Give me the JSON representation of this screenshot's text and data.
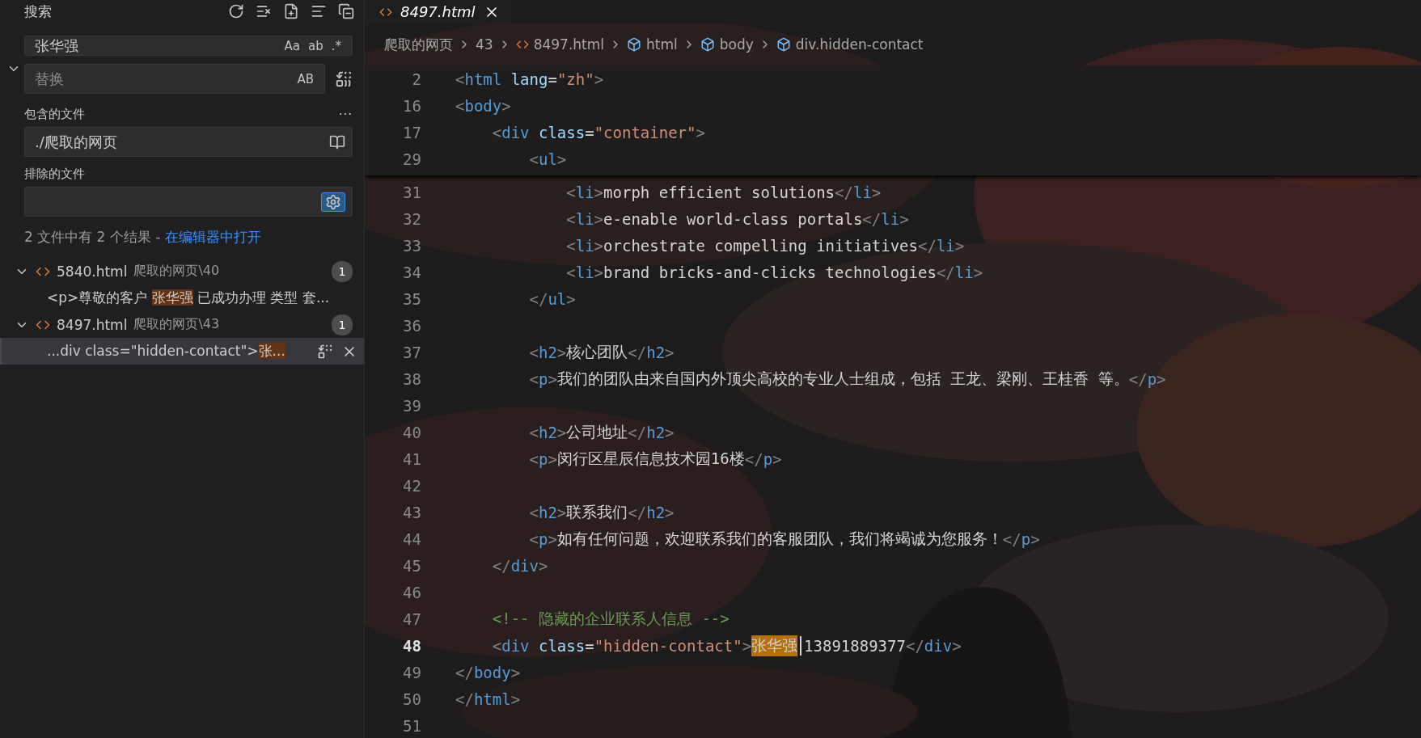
{
  "sidebar": {
    "title": "搜索",
    "search": {
      "value": "张华强",
      "toggles": [
        {
          "label": "Aa",
          "on": false
        },
        {
          "label": "ab",
          "on": false
        },
        {
          "label": ".*",
          "on": false
        }
      ]
    },
    "replace": {
      "placeholder": "替换",
      "toggle": {
        "label": "AB",
        "on": false
      }
    },
    "include": {
      "label": "包含的文件",
      "value": "./爬取的网页",
      "more": "···"
    },
    "exclude": {
      "label": "排除的文件",
      "settings_on": true
    },
    "summary": {
      "text": "2 文件中有 2 个结果 - ",
      "link": "在编辑器中打开"
    },
    "results": [
      {
        "name": "5840.html",
        "path": "爬取的网页\\40",
        "count": "1",
        "expanded": true,
        "children": [
          {
            "prefix": "<p>尊敬的客户 ",
            "match": "张华强",
            "suffix": " 已成功办理 类型 套...",
            "selected": false
          }
        ]
      },
      {
        "name": "8497.html",
        "path": "爬取的网页\\43",
        "count": "1",
        "expanded": true,
        "children": [
          {
            "prefix": "...div class=\"hidden-contact\">",
            "match": "张...",
            "selected": true
          }
        ]
      }
    ]
  },
  "editor": {
    "tabs": [
      {
        "label": "8497.html",
        "selected": true
      }
    ],
    "breadcrumbs": [
      {
        "kind": "folder",
        "label": "爬取的网页"
      },
      {
        "kind": "folder",
        "label": "43"
      },
      {
        "kind": "file",
        "label": "8497.html"
      },
      {
        "kind": "element",
        "label": "html"
      },
      {
        "kind": "element",
        "label": "body"
      },
      {
        "kind": "element",
        "label": "div.hidden-contact"
      }
    ],
    "sticky_lines": [
      {
        "number": "2",
        "current": false,
        "tokens": [
          {
            "kind": "punct",
            "text": "<"
          },
          {
            "kind": "tag",
            "text": "html"
          },
          {
            "kind": "attr",
            "text": " lang"
          },
          {
            "kind": "text",
            "text": "="
          },
          {
            "kind": "string",
            "text": "\"zh\""
          },
          {
            "kind": "punct",
            "text": ">"
          }
        ]
      },
      {
        "number": "16",
        "current": false,
        "tokens": [
          {
            "kind": "punct",
            "text": "<"
          },
          {
            "kind": "tag",
            "text": "body"
          },
          {
            "kind": "punct",
            "text": ">"
          }
        ]
      },
      {
        "number": "17",
        "current": false,
        "tokens": [
          {
            "kind": "punct",
            "text": "    <"
          },
          {
            "kind": "tag",
            "text": "div"
          },
          {
            "kind": "attr",
            "text": " class"
          },
          {
            "kind": "text",
            "text": "="
          },
          {
            "kind": "string",
            "text": "\"container\""
          },
          {
            "kind": "punct",
            "text": ">"
          }
        ]
      },
      {
        "number": "29",
        "current": false,
        "tokens": [
          {
            "kind": "punct",
            "text": "        <"
          },
          {
            "kind": "tag",
            "text": "ul"
          },
          {
            "kind": "punct",
            "text": ">"
          }
        ]
      }
    ],
    "lines": [
      {
        "number": "31",
        "current": false,
        "tokens": [
          {
            "kind": "punct",
            "text": "            <"
          },
          {
            "kind": "tag",
            "text": "li"
          },
          {
            "kind": "punct",
            "text": ">"
          },
          {
            "kind": "text",
            "text": "morph efficient solutions"
          },
          {
            "kind": "punct",
            "text": "</"
          },
          {
            "kind": "tag",
            "text": "li"
          },
          {
            "kind": "punct",
            "text": ">"
          }
        ]
      },
      {
        "number": "32",
        "current": false,
        "tokens": [
          {
            "kind": "punct",
            "text": "            <"
          },
          {
            "kind": "tag",
            "text": "li"
          },
          {
            "kind": "punct",
            "text": ">"
          },
          {
            "kind": "text",
            "text": "e-enable world-class portals"
          },
          {
            "kind": "punct",
            "text": "</"
          },
          {
            "kind": "tag",
            "text": "li"
          },
          {
            "kind": "punct",
            "text": ">"
          }
        ]
      },
      {
        "number": "33",
        "current": false,
        "tokens": [
          {
            "kind": "punct",
            "text": "            <"
          },
          {
            "kind": "tag",
            "text": "li"
          },
          {
            "kind": "punct",
            "text": ">"
          },
          {
            "kind": "text",
            "text": "orchestrate compelling initiatives"
          },
          {
            "kind": "punct",
            "text": "</"
          },
          {
            "kind": "tag",
            "text": "li"
          },
          {
            "kind": "punct",
            "text": ">"
          }
        ]
      },
      {
        "number": "34",
        "current": false,
        "tokens": [
          {
            "kind": "punct",
            "text": "            <"
          },
          {
            "kind": "tag",
            "text": "li"
          },
          {
            "kind": "punct",
            "text": ">"
          },
          {
            "kind": "text",
            "text": "brand bricks-and-clicks technologies"
          },
          {
            "kind": "punct",
            "text": "</"
          },
          {
            "kind": "tag",
            "text": "li"
          },
          {
            "kind": "punct",
            "text": ">"
          }
        ]
      },
      {
        "number": "35",
        "current": false,
        "tokens": [
          {
            "kind": "punct",
            "text": "        </"
          },
          {
            "kind": "tag",
            "text": "ul"
          },
          {
            "kind": "punct",
            "text": ">"
          }
        ]
      },
      {
        "number": "36",
        "current": false
      },
      {
        "number": "37",
        "current": false,
        "tokens": [
          {
            "kind": "punct",
            "text": "        <"
          },
          {
            "kind": "tag",
            "text": "h2"
          },
          {
            "kind": "punct",
            "text": ">"
          },
          {
            "kind": "text",
            "text": "核心团队"
          },
          {
            "kind": "punct",
            "text": "</"
          },
          {
            "kind": "tag",
            "text": "h2"
          },
          {
            "kind": "punct",
            "text": ">"
          }
        ]
      },
      {
        "number": "38",
        "current": false,
        "tokens": [
          {
            "kind": "punct",
            "text": "        <"
          },
          {
            "kind": "tag",
            "text": "p"
          },
          {
            "kind": "punct",
            "text": ">"
          },
          {
            "kind": "text",
            "text": "我们的团队由来自国内外顶尖高校的专业人士组成，包括 王龙、梁刚、王桂香 等。"
          },
          {
            "kind": "punct",
            "text": "</"
          },
          {
            "kind": "tag",
            "text": "p"
          },
          {
            "kind": "punct",
            "text": ">"
          }
        ]
      },
      {
        "number": "39",
        "current": false
      },
      {
        "number": "40",
        "current": false,
        "tokens": [
          {
            "kind": "punct",
            "text": "        <"
          },
          {
            "kind": "tag",
            "text": "h2"
          },
          {
            "kind": "punct",
            "text": ">"
          },
          {
            "kind": "text",
            "text": "公司地址"
          },
          {
            "kind": "punct",
            "text": "</"
          },
          {
            "kind": "tag",
            "text": "h2"
          },
          {
            "kind": "punct",
            "text": ">"
          }
        ]
      },
      {
        "number": "41",
        "current": false,
        "tokens": [
          {
            "kind": "punct",
            "text": "        <"
          },
          {
            "kind": "tag",
            "text": "p"
          },
          {
            "kind": "punct",
            "text": ">"
          },
          {
            "kind": "text",
            "text": "闵行区星辰信息技术园16楼"
          },
          {
            "kind": "punct",
            "text": "</"
          },
          {
            "kind": "tag",
            "text": "p"
          },
          {
            "kind": "punct",
            "text": ">"
          }
        ]
      },
      {
        "number": "42",
        "current": false
      },
      {
        "number": "43",
        "current": false,
        "tokens": [
          {
            "kind": "punct",
            "text": "        <"
          },
          {
            "kind": "tag",
            "text": "h2"
          },
          {
            "kind": "punct",
            "text": ">"
          },
          {
            "kind": "text",
            "text": "联系我们"
          },
          {
            "kind": "punct",
            "text": "</"
          },
          {
            "kind": "tag",
            "text": "h2"
          },
          {
            "kind": "punct",
            "text": ">"
          }
        ]
      },
      {
        "number": "44",
        "current": false,
        "tokens": [
          {
            "kind": "punct",
            "text": "        <"
          },
          {
            "kind": "tag",
            "text": "p"
          },
          {
            "kind": "punct",
            "text": ">"
          },
          {
            "kind": "text",
            "text": "如有任何问题，欢迎联系我们的客服团队，我们将竭诚为您服务！"
          },
          {
            "kind": "punct",
            "text": "</"
          },
          {
            "kind": "tag",
            "text": "p"
          },
          {
            "kind": "punct",
            "text": ">"
          }
        ]
      },
      {
        "number": "45",
        "current": false,
        "tokens": [
          {
            "kind": "punct",
            "text": "    </"
          },
          {
            "kind": "tag",
            "text": "div"
          },
          {
            "kind": "punct",
            "text": ">"
          }
        ]
      },
      {
        "number": "46",
        "current": false
      },
      {
        "number": "47",
        "current": false,
        "tokens": [
          {
            "kind": "comment",
            "text": "    <!-- 隐藏的企业联系人信息 -->"
          }
        ]
      },
      {
        "number": "48",
        "current": true,
        "tokens": [
          {
            "kind": "punct",
            "text": "    <"
          },
          {
            "kind": "tag",
            "text": "div"
          },
          {
            "kind": "attr",
            "text": " class"
          },
          {
            "kind": "text",
            "text": "="
          },
          {
            "kind": "string",
            "text": "\"hidden-contact\""
          },
          {
            "kind": "punct",
            "text": ">"
          },
          {
            "kind": "match",
            "text": "张华强"
          },
          {
            "kind": "cursor"
          },
          {
            "kind": "text",
            "text": "13891889377"
          },
          {
            "kind": "punct",
            "text": "</"
          },
          {
            "kind": "tag",
            "text": "div"
          },
          {
            "kind": "punct",
            "text": ">"
          }
        ]
      },
      {
        "number": "49",
        "current": false,
        "tokens": [
          {
            "kind": "punct",
            "text": "</"
          },
          {
            "kind": "tag",
            "text": "body"
          },
          {
            "kind": "punct",
            "text": ">"
          }
        ]
      },
      {
        "number": "50",
        "current": false,
        "tokens": [
          {
            "kind": "punct",
            "text": "</"
          },
          {
            "kind": "tag",
            "text": "html"
          },
          {
            "kind": "punct",
            "text": ">"
          }
        ]
      },
      {
        "number": "51",
        "current": false
      }
    ]
  }
}
